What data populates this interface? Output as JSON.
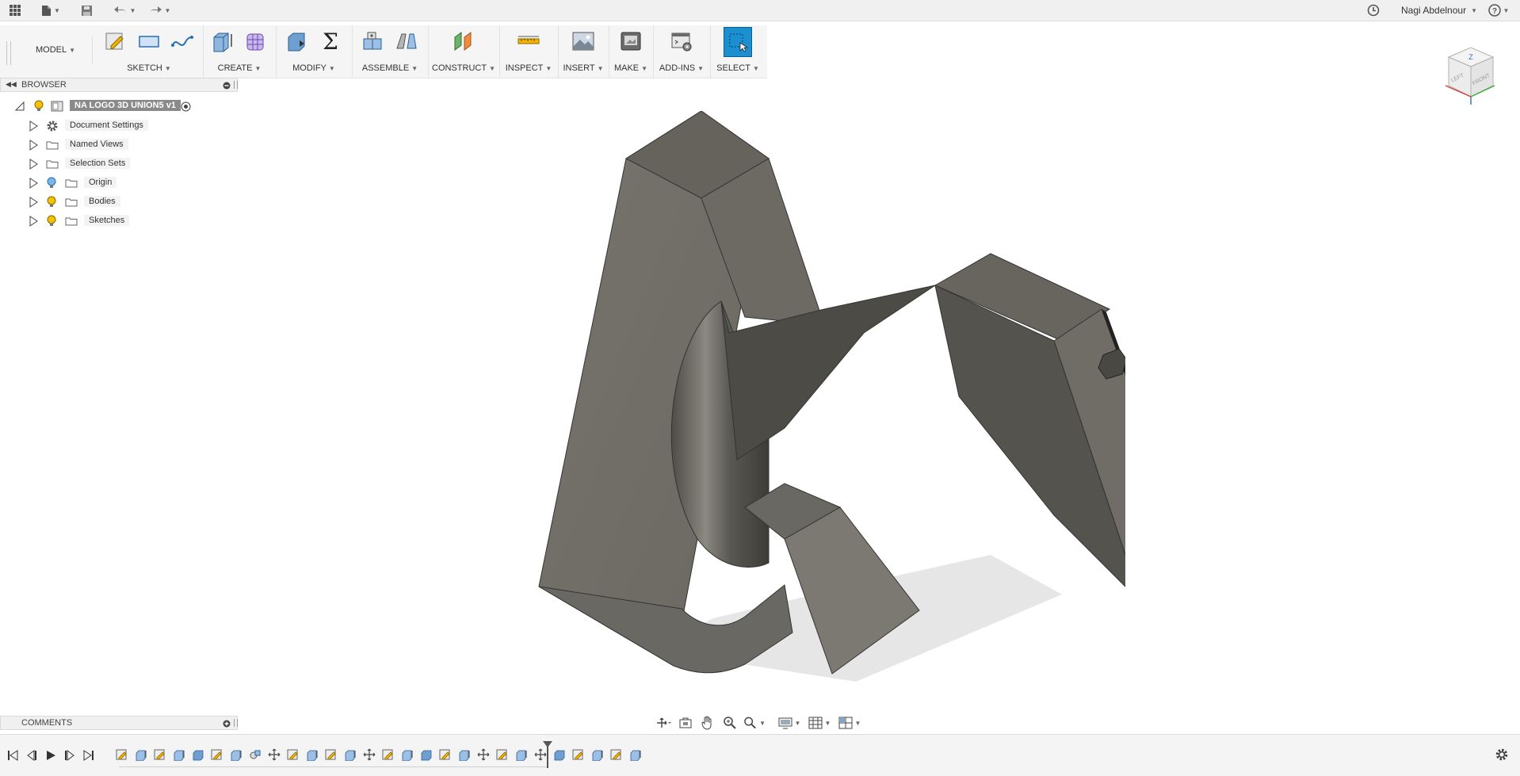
{
  "topbar": {
    "user_name": "Nagi Abdelnour",
    "help_label": "?"
  },
  "toolbar": {
    "workspace": "MODEL",
    "groups": [
      {
        "id": "sketch",
        "label": "SKETCH"
      },
      {
        "id": "create",
        "label": "CREATE"
      },
      {
        "id": "modify",
        "label": "MODIFY"
      },
      {
        "id": "assemble",
        "label": "ASSEMBLE"
      },
      {
        "id": "construct",
        "label": "CONSTRUCT"
      },
      {
        "id": "inspect",
        "label": "INSPECT"
      },
      {
        "id": "insert",
        "label": "INSERT"
      },
      {
        "id": "make",
        "label": "MAKE"
      },
      {
        "id": "addins",
        "label": "ADD-INS"
      },
      {
        "id": "select",
        "label": "SELECT"
      }
    ]
  },
  "browser": {
    "title": "BROWSER",
    "root": "NA LOGO 3D UNION5 v1",
    "items": [
      {
        "label": "Document Settings",
        "icon": "gear-icon"
      },
      {
        "label": "Named Views",
        "icon": "folder-icon"
      },
      {
        "label": "Selection Sets",
        "icon": "folder-icon"
      },
      {
        "label": "Origin",
        "icon": "folder-icon",
        "bulb": "light-blue"
      },
      {
        "label": "Bodies",
        "icon": "folder-icon",
        "bulb": "yellow"
      },
      {
        "label": "Sketches",
        "icon": "folder-icon",
        "bulb": "yellow"
      }
    ]
  },
  "comments": {
    "title": "COMMENTS"
  },
  "viewcube": {
    "top": "Z",
    "left": "LEFT",
    "front": "FRONT"
  },
  "colors": {
    "select_accent": "#1b8fd0",
    "model_face": "#6e6c64",
    "bulb_yellow": "#f2c200",
    "bulb_blue": "#7ab8e6"
  }
}
